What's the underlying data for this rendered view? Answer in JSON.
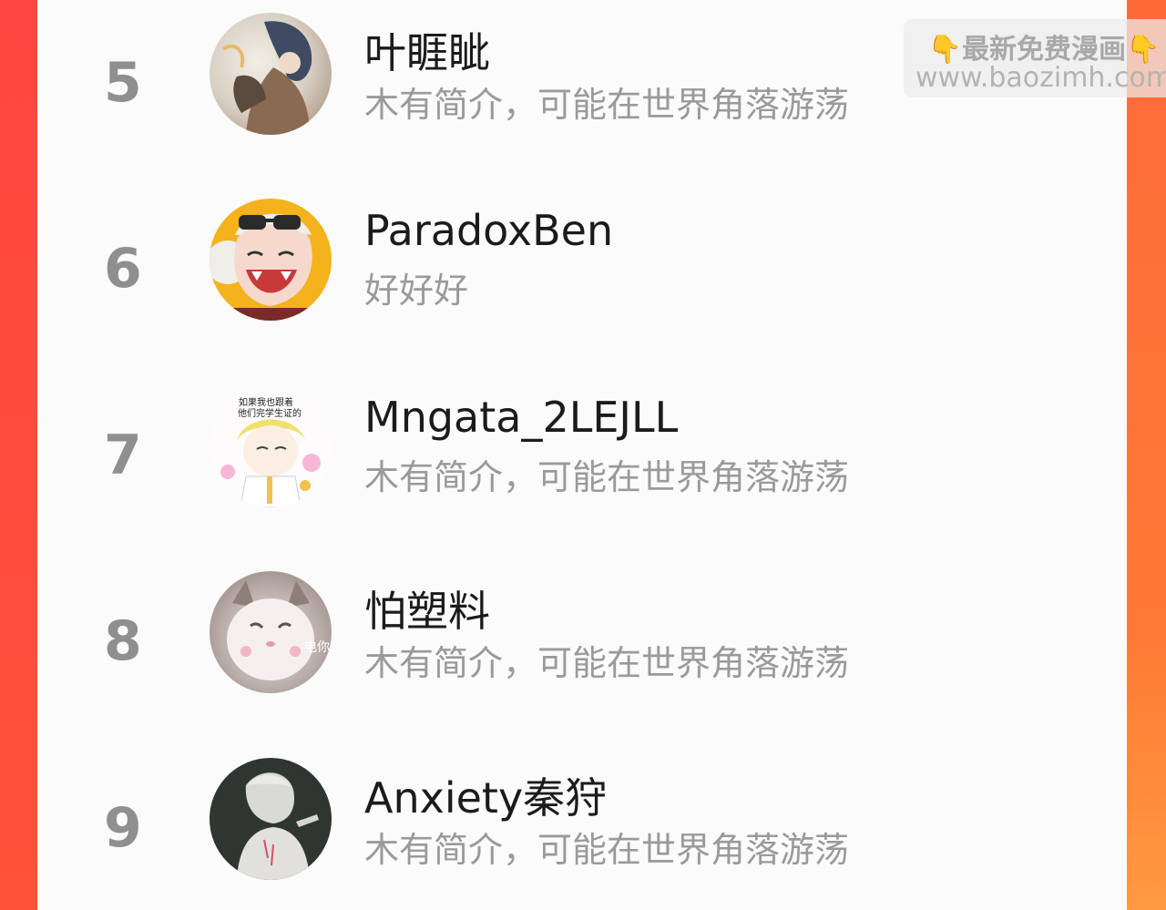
{
  "watermark": {
    "top_text": "最新免费漫画",
    "hand_left": "👇",
    "hand_right": "👇",
    "url": "www.baozimh.com"
  },
  "users": [
    {
      "rank": "5",
      "name": "叶睚眦",
      "bio": "木有简介，可能在世界角落游荡",
      "avatar": "user-avatar-5"
    },
    {
      "rank": "6",
      "name": "ParadoxBen",
      "bio": "好好好",
      "avatar": "user-avatar-6"
    },
    {
      "rank": "7",
      "name": "Mngata_2LEJLL",
      "bio": "木有简介，可能在世界角落游荡",
      "avatar": "user-avatar-7",
      "avatar_caption_1": "如果我也跟着",
      "avatar_caption_2": "他们完学生证的"
    },
    {
      "rank": "8",
      "name": "怕塑料",
      "bio": "木有简介，可能在世界角落游荡",
      "avatar": "user-avatar-8",
      "avatar_caption": "电你"
    },
    {
      "rank": "9",
      "name": "Anxiety秦狩",
      "bio": "木有简介，可能在世界角落游荡",
      "avatar": "user-avatar-9"
    }
  ]
}
